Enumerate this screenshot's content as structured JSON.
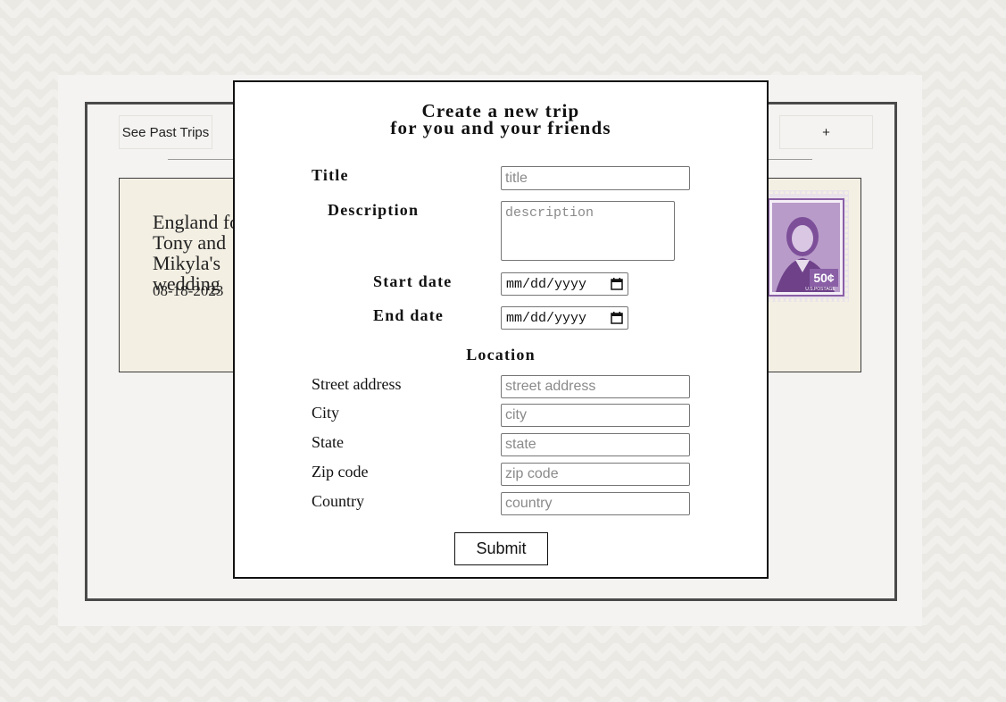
{
  "background": {
    "see_past_label": "See Past Trips",
    "add_label": "+",
    "trip": {
      "title": "England for Tony and Mikyla's wedding",
      "date": "08-18-2023"
    }
  },
  "modal": {
    "title_line1": "Create a new trip",
    "title_line2": "for you and your friends",
    "fields": {
      "title_label": "Title",
      "title_placeholder": "title",
      "description_label": "Description",
      "description_placeholder": "description",
      "start_label": "Start date",
      "start_value": "mm/dd/yyyy",
      "end_label": "End date",
      "end_value": "mm/dd/yyyy"
    },
    "location": {
      "heading": "Location",
      "street_label": "Street address",
      "street_placeholder": "street address",
      "city_label": "City",
      "city_placeholder": "city",
      "state_label": "State",
      "state_placeholder": "state",
      "zip_label": "Zip code",
      "zip_placeholder": "zip code",
      "country_label": "Country",
      "country_placeholder": "country"
    },
    "submit_label": "Submit"
  },
  "stamp": {
    "value": "50¢",
    "caption": "U.S.POSTAGE",
    "color": "#8a5fa6"
  }
}
